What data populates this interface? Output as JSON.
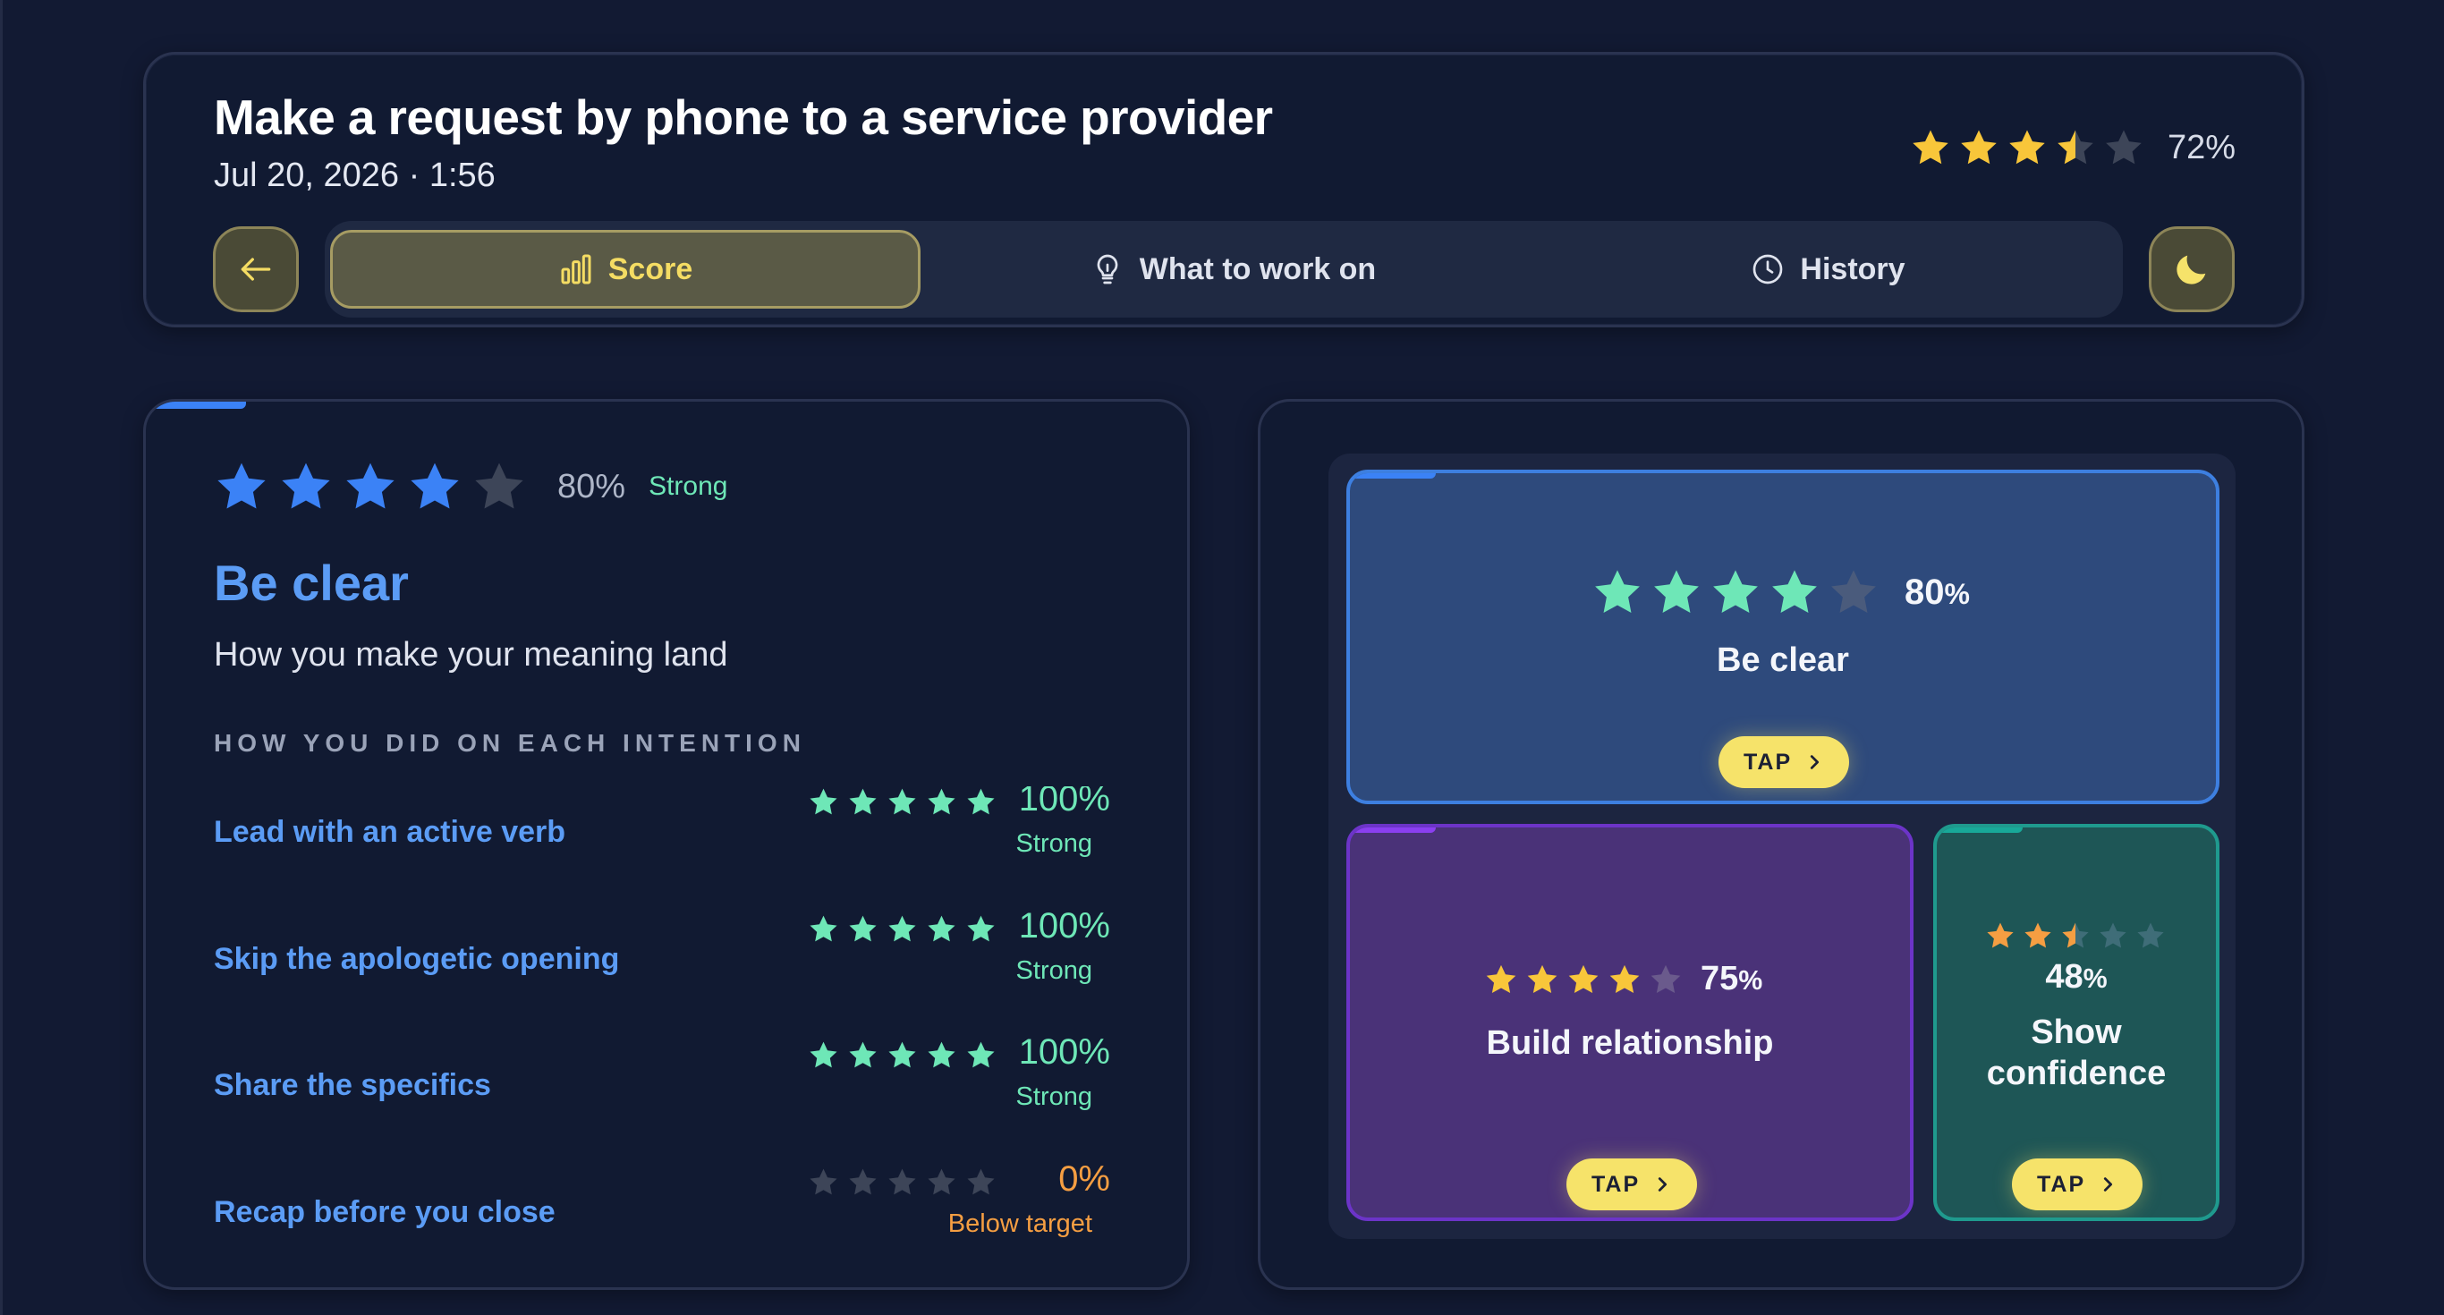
{
  "header": {
    "title": "Make a request by phone to a service provider",
    "subtitle": "Jul 20, 2026 · 1:56",
    "overall_stars": 3.5,
    "overall_percent": "72%"
  },
  "tabs": [
    {
      "label": "Score",
      "icon": "bar-chart-icon",
      "active": true
    },
    {
      "label": "What to work on",
      "icon": "lightbulb-icon",
      "active": false
    },
    {
      "label": "History",
      "icon": "clock-icon",
      "active": false
    }
  ],
  "detail": {
    "stars": 4,
    "percent": "80%",
    "strength": "Strong",
    "title": "Be clear",
    "subtitle": "How you make your meaning land",
    "section_label": "HOW YOU DID ON EACH INTENTION",
    "intentions": [
      {
        "name": "Lead with an active verb",
        "stars": 5,
        "percent": "100%",
        "strength": "Strong"
      },
      {
        "name": "Skip the apologetic opening",
        "stars": 5,
        "percent": "100%",
        "strength": "Strong"
      },
      {
        "name": "Share the specifics",
        "stars": 5,
        "percent": "100%",
        "strength": "Strong"
      },
      {
        "name": "Recap before you close",
        "stars": 0,
        "percent": "0%",
        "strength": "Below target"
      }
    ]
  },
  "skills": [
    {
      "name": "Be clear",
      "stars": 4,
      "percent": "80",
      "tap": "TAP"
    },
    {
      "name": "Build relationship",
      "stars": 4,
      "percent": "75",
      "tap": "TAP"
    },
    {
      "name": "Show confidence",
      "name_line1": "Show",
      "name_line2": "confidence",
      "stars": 2.5,
      "percent": "48",
      "tap": "TAP"
    }
  ],
  "percent_sign": "%",
  "colors": {
    "background": "#121a33",
    "accent_yellow": "#f6e36a",
    "star_gold": "#f8c63a",
    "star_blue": "#3b82f6",
    "star_green": "#6ee7b7",
    "star_orange": "#f59e42",
    "star_empty": "#3d4558",
    "link_blue": "#5b9cf5"
  }
}
